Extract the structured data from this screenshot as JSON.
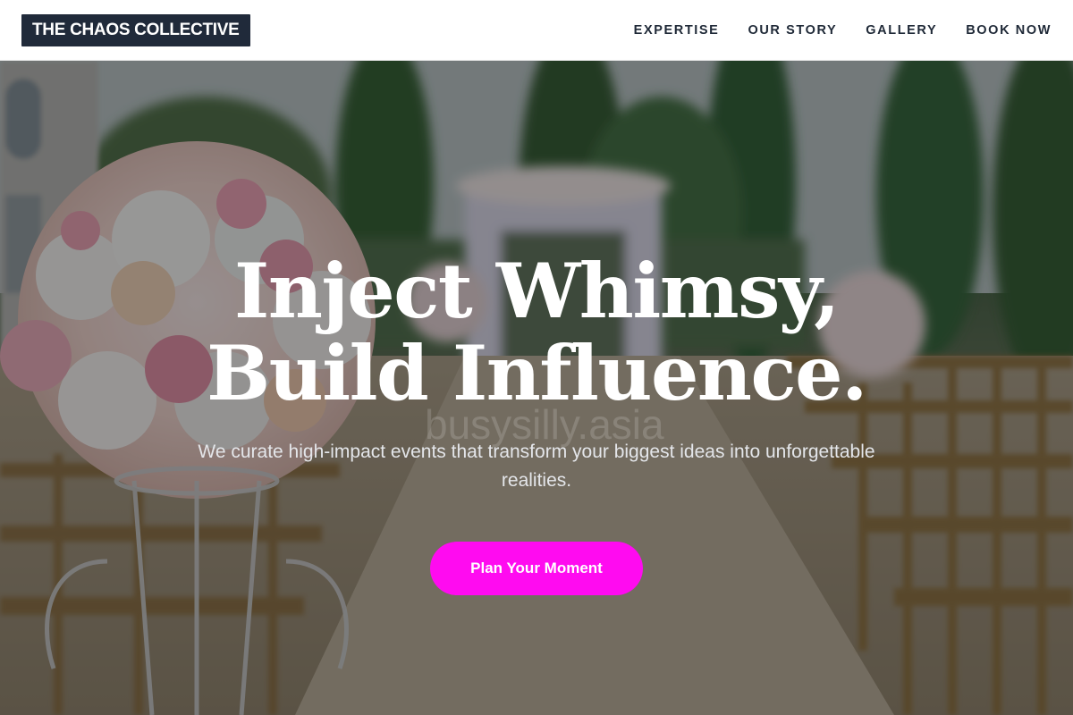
{
  "brand": {
    "name": "THE CHAOS COLLECTIVE"
  },
  "nav": {
    "items": [
      {
        "label": "EXPERTISE"
      },
      {
        "label": "OUR STORY"
      },
      {
        "label": "GALLERY"
      },
      {
        "label": "BOOK NOW"
      }
    ]
  },
  "hero": {
    "headline_line1": "Inject Whimsy,",
    "headline_line2": "Build Influence.",
    "subtitle": "We curate high-impact events that transform your biggest ideas into unforgettable realities.",
    "cta_label": "Plan Your Moment",
    "watermark": "busysilly.asia",
    "background_description": "outdoor wedding ceremony aisle with flower arrangements and wooden chairs"
  },
  "colors": {
    "logo_bg": "#202a3a",
    "cta_bg": "#ff0bf0",
    "nav_text": "#1f2937"
  }
}
